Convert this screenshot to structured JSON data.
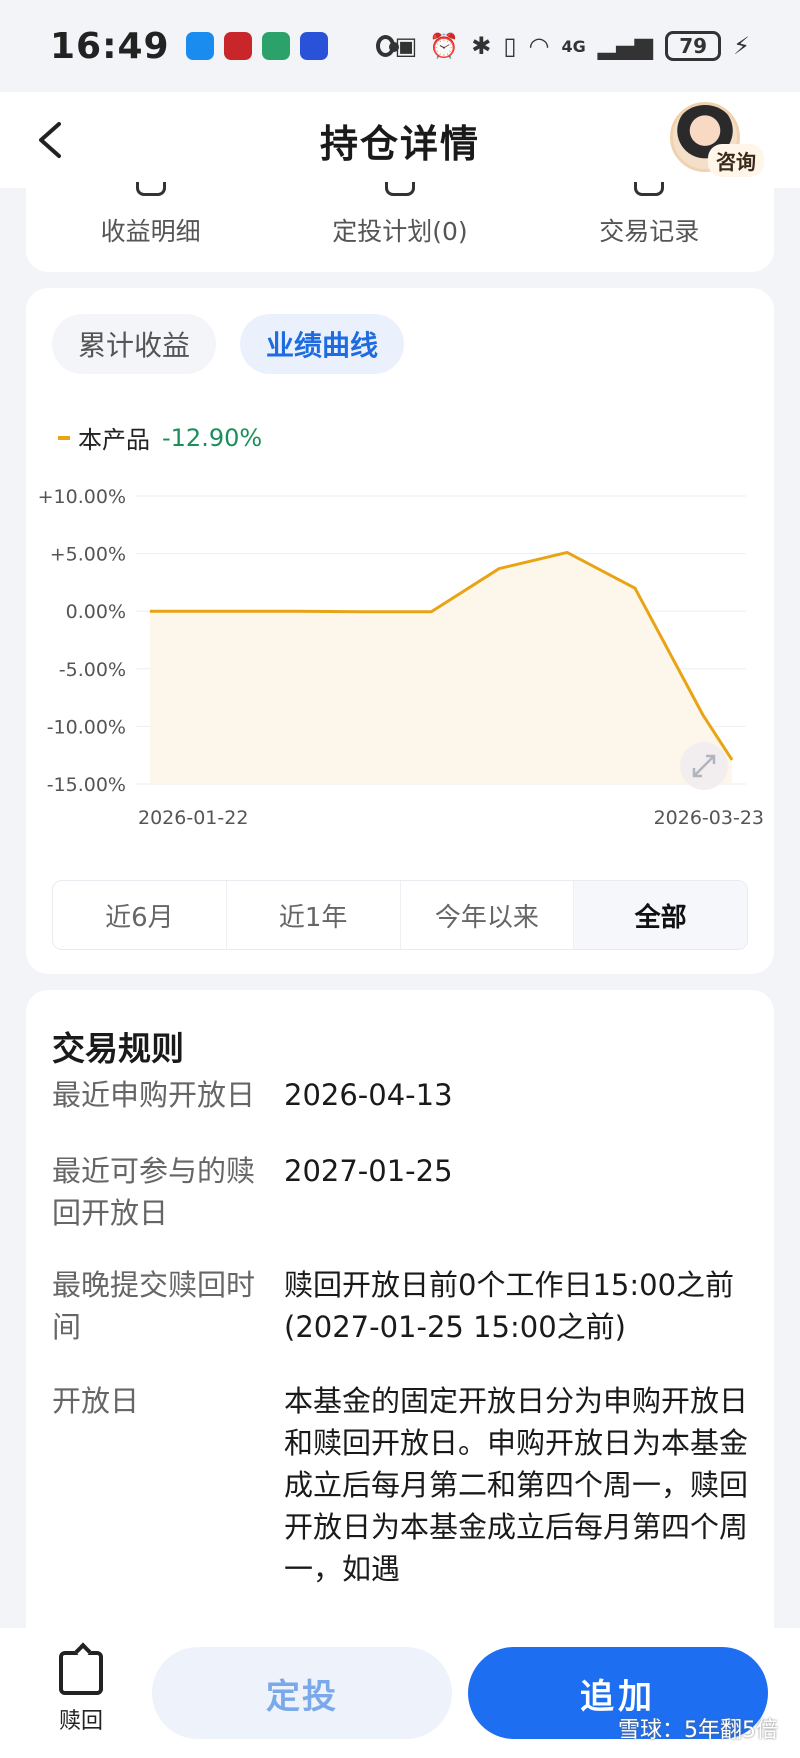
{
  "status_bar": {
    "time": "16:49",
    "network": "4G",
    "battery": "79"
  },
  "header": {
    "title": "持仓详情",
    "consult_label": "咨询"
  },
  "quick_tools": [
    {
      "label": "收益明细"
    },
    {
      "label": "定投计划(0)"
    },
    {
      "label": "交易记录"
    }
  ],
  "chart_tabs": [
    {
      "label": "累计收益",
      "active": false
    },
    {
      "label": "业绩曲线",
      "active": true
    }
  ],
  "legend": {
    "series_name": "本产品",
    "value": "-12.90%",
    "color": "#e9a416"
  },
  "chart_data": {
    "type": "line",
    "title": "",
    "xlabel": "",
    "ylabel": "",
    "y_ticks": [
      "+10.00%",
      "+5.00%",
      "0.00%",
      "-5.00%",
      "-10.00%",
      "-15.00%"
    ],
    "ylim": [
      -15,
      10
    ],
    "x_tick_labels": [
      "2026-01-22",
      "2026-03-23"
    ],
    "series": [
      {
        "name": "本产品",
        "x": [
          "2026-01-22",
          "2026-01-30",
          "2026-02-06",
          "2026-02-13",
          "2026-02-20",
          "2026-02-27",
          "2026-03-06",
          "2026-03-13",
          "2026-03-20",
          "2026-03-23"
        ],
        "values": [
          0.0,
          0.0,
          0.0,
          -0.05,
          -0.05,
          3.7,
          5.1,
          2.0,
          -9.0,
          -12.9
        ]
      }
    ],
    "grid": true
  },
  "range_tabs": [
    {
      "label": "近6月",
      "active": false
    },
    {
      "label": "近1年",
      "active": false
    },
    {
      "label": "今年以来",
      "active": false
    },
    {
      "label": "全部",
      "active": true
    }
  ],
  "trading_rules": {
    "title": "交易规则",
    "rows": [
      {
        "label": "最近申购开放日",
        "value": "2026-04-13"
      },
      {
        "label": "最近可参与的赎回开放日",
        "value": "2027-01-25"
      },
      {
        "label": "最晚提交赎回时间",
        "value": "赎回开放日前0个工作日15:00之前(2027-01-25 15:00之前)"
      },
      {
        "label": "开放日",
        "value": "本基金的固定开放日分为申购开放日和赎回开放日。申购开放日为本基金成立后每月第二和第四个周一，赎回开放日为本基金成立后每月第四个周一，如遇"
      }
    ]
  },
  "bottom_bar": {
    "redeem_label": "赎回",
    "dingtou_label": "定投",
    "add_label": "追加"
  },
  "watermark": "雪球：5年翻5倍"
}
